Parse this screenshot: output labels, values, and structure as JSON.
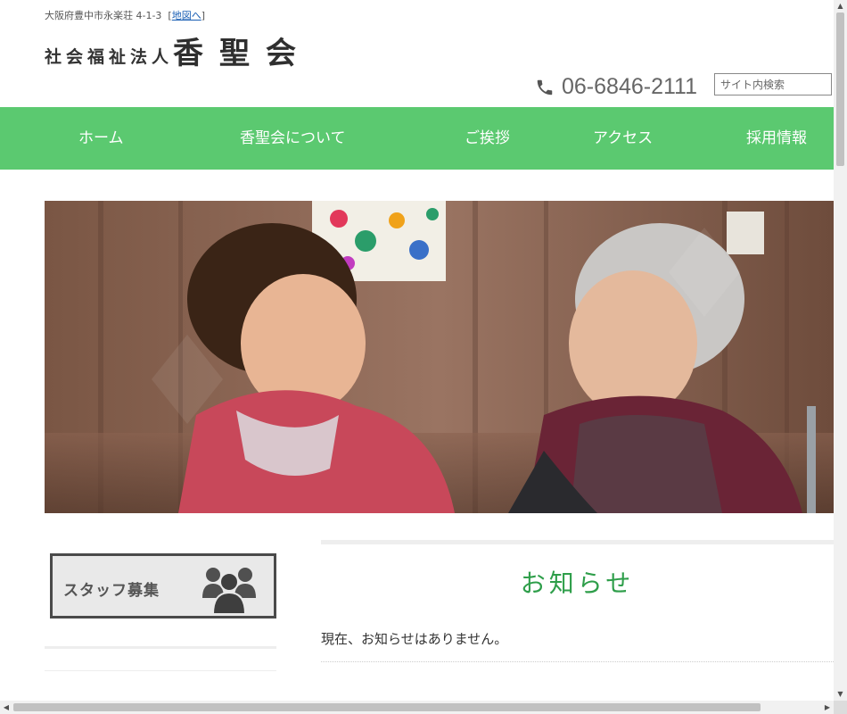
{
  "header": {
    "address": "大阪府豊中市永楽荘 4-1-3",
    "map_link": "地図へ",
    "logo_prefix": "社会福祉法人",
    "logo_name": "香聖会",
    "phone": "06-6846-2111",
    "search_placeholder": "サイト内検索"
  },
  "nav": {
    "items": [
      {
        "label": "ホーム"
      },
      {
        "label": "香聖会について"
      },
      {
        "label": "ご挨拶"
      },
      {
        "label": "アクセス"
      },
      {
        "label": "採用情報"
      }
    ]
  },
  "sidebar": {
    "staff_banner": "スタッフ募集"
  },
  "news": {
    "title": "お知らせ",
    "body": "現在、お知らせはありません。"
  },
  "colors": {
    "nav_bg": "#5bc970",
    "news_title": "#2e9e4a"
  }
}
